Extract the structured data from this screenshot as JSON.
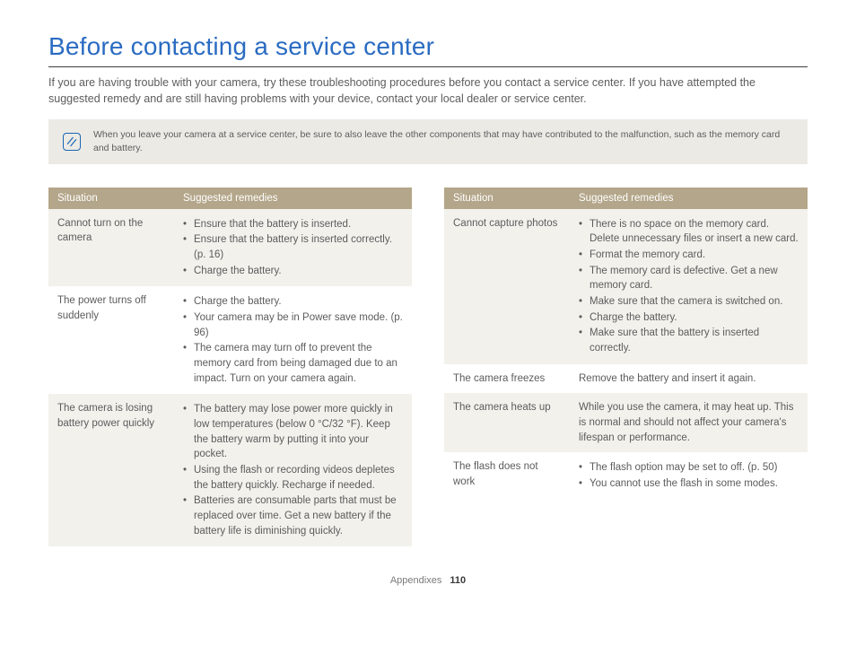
{
  "title": "Before contacting a service center",
  "intro": "If you are having trouble with your camera, try these troubleshooting procedures before you contact a service center. If you have attempted the suggested remedy and are still having problems with your device, contact your local dealer or service center.",
  "note": "When you leave your camera at a service center, be sure to also leave the other components that may have contributed to the malfunction, such as the memory card and battery.",
  "headers": {
    "situation": "Situation",
    "remedies": "Suggested remedies"
  },
  "left": [
    {
      "situation": "Cannot turn on the camera",
      "type": "list",
      "items": [
        "Ensure that the battery is inserted.",
        "Ensure that the battery is inserted correctly. (p. 16)",
        "Charge the battery."
      ]
    },
    {
      "situation": "The power turns off suddenly",
      "type": "list",
      "items": [
        "Charge the battery.",
        "Your camera may be in Power save mode. (p. 96)",
        "The camera may turn off to prevent the memory card from being damaged due to an impact. Turn on your camera again."
      ]
    },
    {
      "situation": "The camera is losing battery power quickly",
      "type": "list",
      "items": [
        "The battery may lose power more quickly in low temperatures (below 0 °C/32 °F). Keep the battery warm by putting it into your pocket.",
        "Using the flash or recording videos depletes the battery quickly. Recharge if needed.",
        "Batteries are consumable parts that must be replaced over time. Get a new battery if the battery life is diminishing quickly."
      ]
    }
  ],
  "right": [
    {
      "situation": "Cannot capture photos",
      "type": "list",
      "items": [
        "There is no space on the memory card. Delete unnecessary files or insert a new card.",
        "Format the memory card.",
        "The memory card is defective. Get a new memory card.",
        "Make sure that the camera is switched on.",
        "Charge the battery.",
        "Make sure that the battery is inserted correctly."
      ]
    },
    {
      "situation": "The camera freezes",
      "type": "text",
      "text": "Remove the battery and insert it again."
    },
    {
      "situation": "The camera heats up",
      "type": "text",
      "text": "While you use the camera, it may heat up. This is normal and should not affect your camera's lifespan or performance."
    },
    {
      "situation": "The flash does not work",
      "type": "list",
      "items": [
        "The flash option may be set to off. (p. 50)",
        "You cannot use the flash in some modes."
      ]
    }
  ],
  "footer": {
    "section": "Appendixes",
    "page": "110"
  }
}
